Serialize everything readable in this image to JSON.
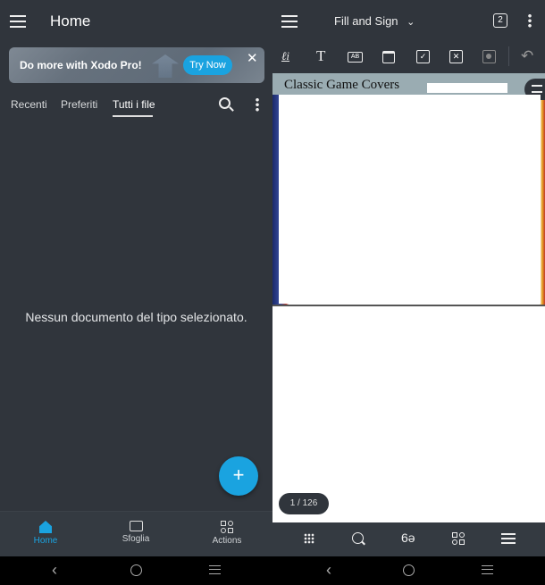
{
  "left": {
    "header": {
      "title": "Home"
    },
    "banner": {
      "text": "Do more with Xodo Pro!",
      "button": "Try Now"
    },
    "tabs": [
      {
        "label": "Recenti"
      },
      {
        "label": "Preferiti"
      },
      {
        "label": "Tutti i file",
        "active": true
      }
    ],
    "empty_message": "Nessun documento del tipo selezionato.",
    "fab": "+",
    "bottom_nav": [
      {
        "label": "Home",
        "icon": "home-icon",
        "active": true
      },
      {
        "label": "Sfoglia",
        "icon": "folder-icon"
      },
      {
        "label": "Actions",
        "icon": "grid-icon"
      }
    ]
  },
  "right": {
    "header": {
      "mode": "Fill and Sign",
      "tab_count": "2"
    },
    "toolbar": [
      "signature-icon",
      "text-icon",
      "comb-field-icon",
      "date-icon",
      "checkmark-icon",
      "cross-icon",
      "dot-icon",
      "undo-icon"
    ],
    "document": {
      "title": "Classic Game Covers"
    },
    "page_indicator": "1 / 126",
    "bottom_toolbar": [
      "thumbnails-icon",
      "search-icon",
      "reading-mode-icon",
      "grid-icon",
      "outline-icon"
    ]
  },
  "colors": {
    "accent": "#1aa3e0",
    "background": "#30353c"
  }
}
